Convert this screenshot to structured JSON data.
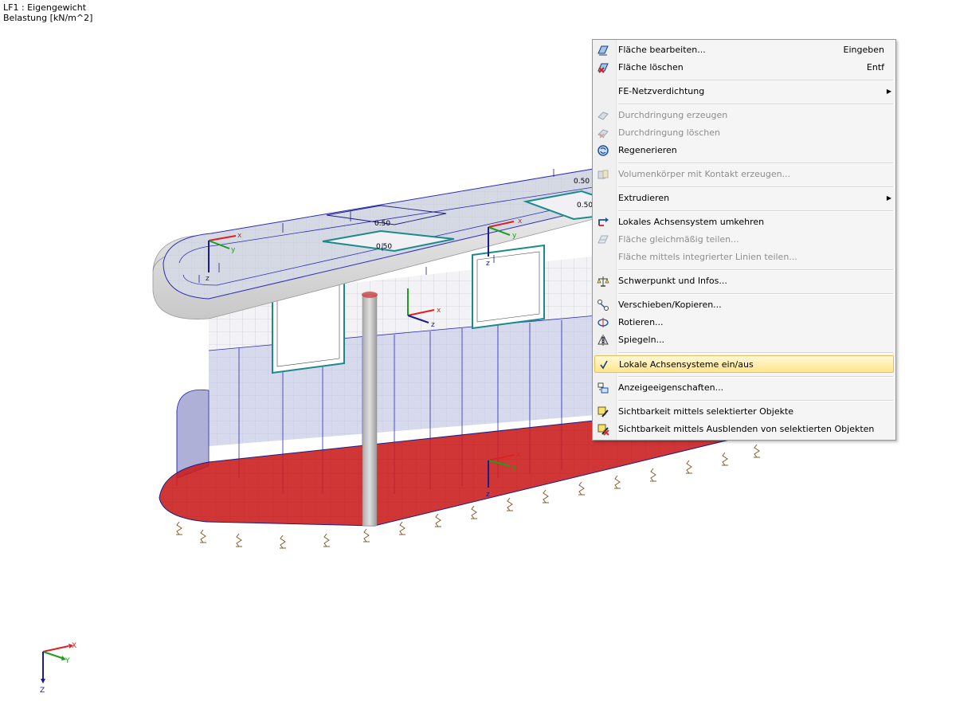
{
  "info": {
    "load_case": "LF1 : Eigengewicht",
    "unit": "Belastung [kN/m^2]"
  },
  "axis_labels": {
    "x": "X",
    "y": "Y",
    "z": "Z"
  },
  "local_axis_labels": {
    "x": "x",
    "y": "y",
    "z": "z"
  },
  "opening_labels": [
    "0.50",
    "0.50",
    "0.50",
    "0.50"
  ],
  "context_menu": {
    "items": [
      {
        "label": "Fläche bearbeiten...",
        "shortcut": "Eingeben",
        "icon": "edit-surface-icon",
        "enabled": true
      },
      {
        "label": "Fläche löschen",
        "shortcut": "Entf",
        "icon": "delete-surface-icon",
        "enabled": true
      },
      {
        "label": "FE-Netzverdichtung",
        "submenu": true,
        "enabled": true
      },
      {
        "label": "Durchdringung erzeugen",
        "icon": "create-intersection-icon",
        "enabled": false
      },
      {
        "label": "Durchdringung löschen",
        "icon": "delete-intersection-icon",
        "enabled": false
      },
      {
        "label": "Regenerieren",
        "icon": "regenerate-icon",
        "enabled": true
      },
      {
        "label": "Volumenkörper mit Kontakt erzeugen...",
        "icon": "contact-solid-icon",
        "enabled": false
      },
      {
        "label": "Extrudieren",
        "submenu": true,
        "enabled": true
      },
      {
        "label": "Lokales Achsensystem umkehren",
        "icon": "reverse-axes-icon",
        "enabled": true
      },
      {
        "label": "Fläche gleichmäßig teilen...",
        "icon": "divide-surface-icon",
        "enabled": false
      },
      {
        "label": "Fläche mittels integrierter Linien teilen...",
        "enabled": false
      },
      {
        "label": "Schwerpunkt und Infos...",
        "icon": "centroid-icon",
        "enabled": true
      },
      {
        "label": "Verschieben/Kopieren...",
        "icon": "move-copy-icon",
        "enabled": true
      },
      {
        "label": "Rotieren...",
        "icon": "rotate-icon",
        "enabled": true
      },
      {
        "label": "Spiegeln...",
        "icon": "mirror-icon",
        "enabled": true
      },
      {
        "label": "Lokale Achsensysteme ein/aus",
        "icon": "checkmark-icon",
        "enabled": true,
        "checked": true
      },
      {
        "label": "Anzeigeeigenschaften...",
        "icon": "display-properties-icon",
        "enabled": true
      },
      {
        "label": "Sichtbarkeit mittels selektierter Objekte",
        "icon": "visibility-selected-icon",
        "enabled": true
      },
      {
        "label": "Sichtbarkeit mittels Ausblenden von selektierten Objekten",
        "icon": "visibility-hide-icon",
        "enabled": true
      }
    ]
  },
  "colors": {
    "menu_background": "#f5f5f5",
    "highlight": "#ffe58a",
    "slab": "#d5d9e3",
    "foundation": "#c91a1a",
    "wall_mesh": "#2b2bb8",
    "axis_x": "#e02020",
    "axis_y": "#1aa01a",
    "axis_z": "#1c1cc8"
  }
}
